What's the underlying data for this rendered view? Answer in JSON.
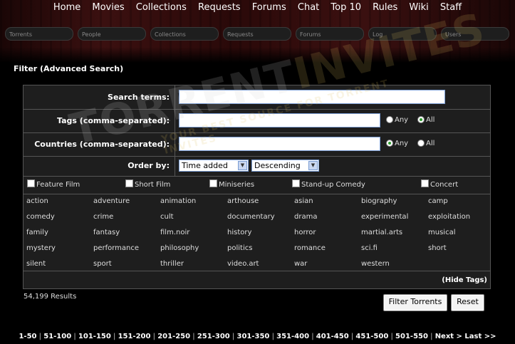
{
  "nav": [
    "Home",
    "Movies",
    "Collections",
    "Requests",
    "Forums",
    "Chat",
    "Top 10",
    "Rules",
    "Wiki",
    "Staff"
  ],
  "search_bar": [
    "Torrents",
    "People",
    "Collections",
    "Requests",
    "Forums",
    "Log",
    "Users"
  ],
  "filter_title": "Filter (Advanced Search)",
  "form": {
    "search_terms_label": "Search terms:",
    "tags_label": "Tags (comma-separated):",
    "countries_label": "Countries (comma-separated):",
    "order_by_label": "Order by:",
    "any_label": "Any",
    "all_label": "All",
    "tags_mode": "All",
    "countries_mode": "Any",
    "order_by_value": "Time added",
    "order_dir_value": "Descending"
  },
  "formats": [
    "Feature Film",
    "Short Film",
    "Miniseries",
    "Stand-up Comedy",
    "Concert"
  ],
  "tags": [
    [
      "action",
      "adventure",
      "animation",
      "arthouse",
      "asian",
      "biography",
      "camp"
    ],
    [
      "comedy",
      "crime",
      "cult",
      "documentary",
      "drama",
      "experimental",
      "exploitation"
    ],
    [
      "family",
      "fantasy",
      "film.noir",
      "history",
      "horror",
      "martial.arts",
      "musical"
    ],
    [
      "mystery",
      "performance",
      "philosophy",
      "politics",
      "romance",
      "sci.fi",
      "short"
    ],
    [
      "silent",
      "sport",
      "thriller",
      "video.art",
      "war",
      "western"
    ]
  ],
  "hide_tags": "(Hide Tags)",
  "results": "54,199 Results",
  "buttons": {
    "filter": "Filter Torrents",
    "reset": "Reset"
  },
  "pagination": [
    "1-50",
    "51-100",
    "101-150",
    "151-200",
    "201-250",
    "251-300",
    "301-350",
    "351-400",
    "401-450",
    "451-500",
    "501-550"
  ],
  "next_label": "Next >",
  "last_label": "Last >>",
  "watermark": {
    "line1": "TORRENTINVITES",
    "line2": "YOUR BEST SOURCE FOR TORRENT INVITES",
    "color1": "#cfcfcf",
    "color2": "#e0c060"
  }
}
